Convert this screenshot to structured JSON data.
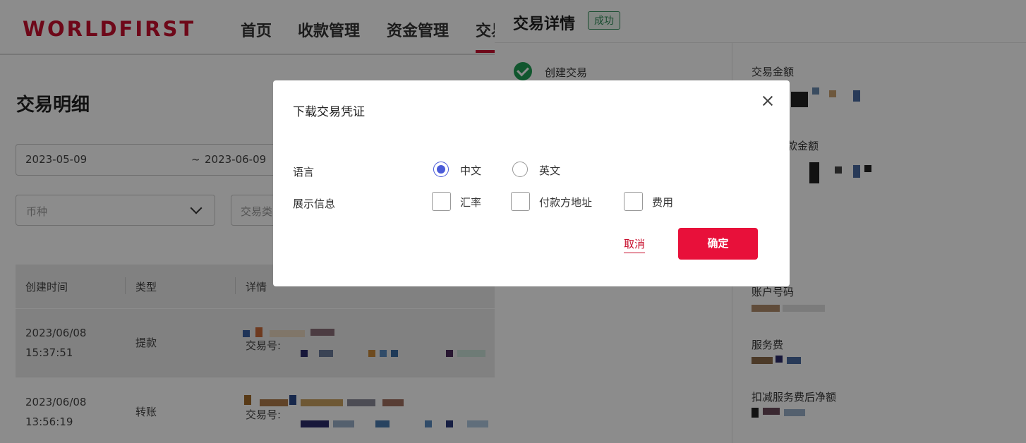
{
  "header": {
    "logo": "WORLDFIRST",
    "nav": [
      "首页",
      "收款管理",
      "资金管理",
      "交易"
    ]
  },
  "page": {
    "title": "交易明细",
    "date_start": "2023-05-09",
    "date_sep": "~",
    "date_end": "2023-06-09",
    "currency_placeholder": "币种",
    "type_placeholder": "交易类"
  },
  "table": {
    "headers": [
      "创建时间",
      "类型",
      "详情"
    ],
    "rows": [
      {
        "date": "2023/06/08",
        "time": "15:37:51",
        "type": "提款",
        "txn_label": "交易号:"
      },
      {
        "date": "2023/06/08",
        "time": "13:56:19",
        "type": "转账",
        "txn_label": "交易号:"
      }
    ]
  },
  "panel": {
    "title": "交易详情",
    "status": "成功",
    "step": "创建交易",
    "fields": [
      "交易金额",
      "款金额",
      "账户号码",
      "服务费",
      "扣减服务费后净额"
    ]
  },
  "modal": {
    "title": "下载交易凭证",
    "language_label": "语言",
    "language_options": [
      "中文",
      "英文"
    ],
    "language_selected": "中文",
    "display_label": "展示信息",
    "display_options": [
      "汇率",
      "付款方地址",
      "费用"
    ],
    "cancel": "取消",
    "confirm": "确定"
  },
  "colors": {
    "brand": "#c8102e",
    "confirm": "#e8103a",
    "radio": "#4a5bd8",
    "success": "#2e8b57"
  }
}
